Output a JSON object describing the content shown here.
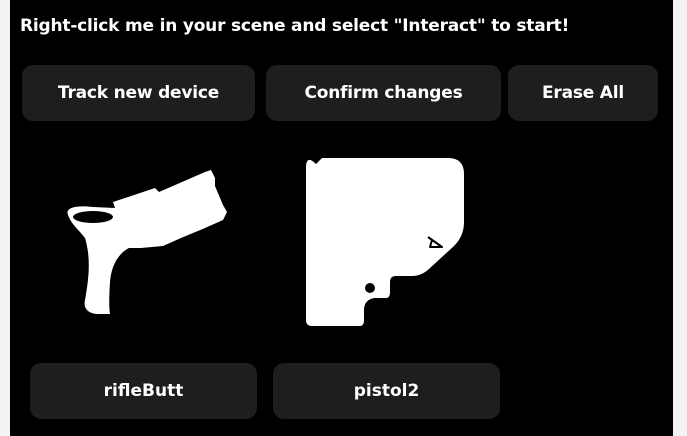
{
  "header": {
    "instruction": "Right-click me in your scene and select \"Interact\" to start!"
  },
  "toolbar": {
    "track_label": "Track new device",
    "confirm_label": "Confirm changes",
    "erase_label": "Erase All"
  },
  "devices": [
    {
      "name": "rifleButt",
      "icon": "rifle-butt-icon"
    },
    {
      "name": "pistol2",
      "icon": "pistol-grip-icon"
    }
  ],
  "colors": {
    "panel_bg": "#000000",
    "button_bg": "#1e1e1e",
    "text": "#ffffff",
    "outer_bg": "#f3f3f3"
  }
}
